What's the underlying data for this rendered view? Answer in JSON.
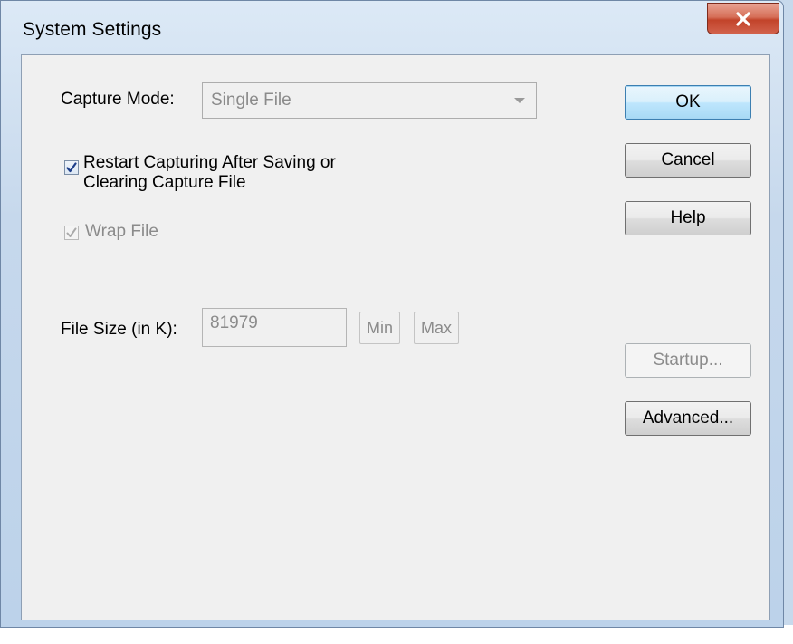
{
  "window": {
    "title": "System Settings"
  },
  "capture_mode": {
    "label": "Capture Mode:",
    "value": "Single File"
  },
  "restart_capturing": {
    "label_line1": "Restart Capturing After Saving or",
    "label_line2": "Clearing Capture File",
    "checked": true
  },
  "wrap_file": {
    "label": "Wrap File",
    "checked": true,
    "enabled": false
  },
  "file_size": {
    "label": "File Size (in K):",
    "value": "81979",
    "min_label": "Min",
    "max_label": "Max"
  },
  "buttons": {
    "ok": "OK",
    "cancel": "Cancel",
    "help": "Help",
    "startup": "Startup...",
    "advanced": "Advanced..."
  },
  "colors": {
    "close_button": "#c7432b",
    "checkmark": "#1e3f8a",
    "disabled_text": "#8b8b8b"
  },
  "icons": {
    "close": "close-icon",
    "dropdown": "chevron-down-icon",
    "check": "checkmark-icon"
  }
}
